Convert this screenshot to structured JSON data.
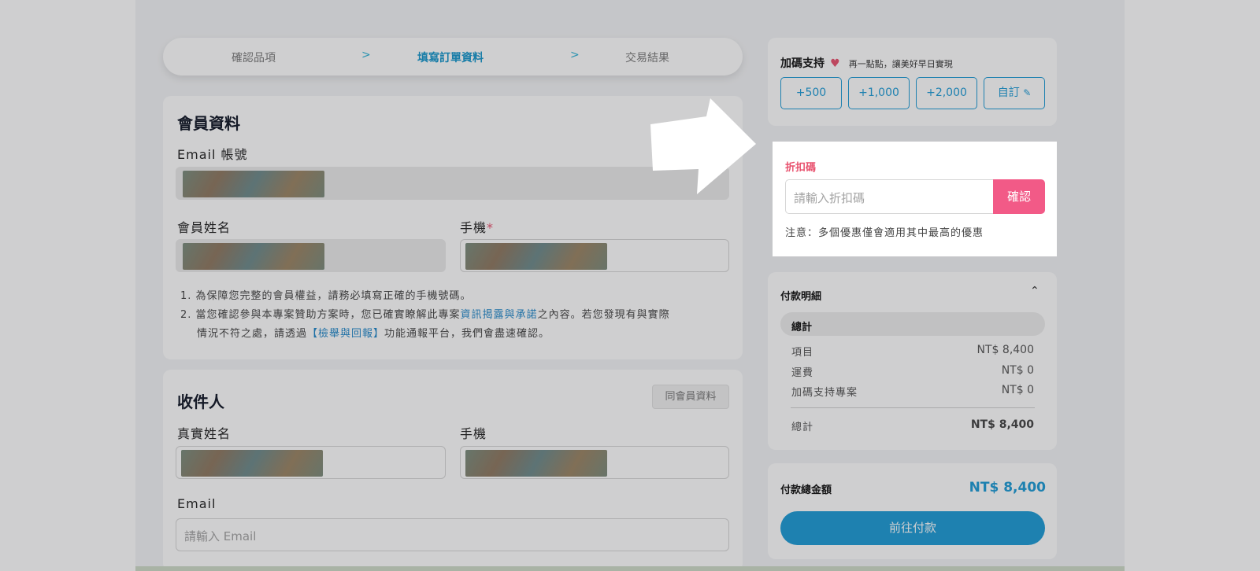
{
  "stepper": {
    "steps": [
      "確認品項",
      "填寫訂單資料",
      "交易結果"
    ],
    "separator": ">"
  },
  "member": {
    "title": "會員資料",
    "email_label": "Email 帳號",
    "name_label": "會員姓名",
    "phone_label": "手機",
    "required_mark": "*",
    "note1": "1. 為保障您完整的會員權益，請務必填寫正確的手機號碼。",
    "note2_pre": "2. 當您確認參與本專案贊助方案時，您已確實瞭解此專案",
    "note2_link": "資訊揭露與承諾",
    "note2_post": "之內容。若您發現有與實際",
    "note3_pre": "情況不符之處，請透過",
    "note3_link": "【檢舉與回報】",
    "note3_post": "功能通報平台，我們會盡速確認。"
  },
  "recipient": {
    "title": "收件人",
    "same_button": "同會員資料",
    "name_label": "真實姓名",
    "phone_label": "手機",
    "email_label": "Email",
    "email_placeholder": "請輸入 Email"
  },
  "support": {
    "title": "加碼支持",
    "subtitle": "再一點點，讓美好早日實現",
    "amounts": [
      "+500",
      "+1,000",
      "+2,000",
      "自訂"
    ]
  },
  "coupon": {
    "label": "折扣碼",
    "placeholder": "請輸入折扣碼",
    "confirm": "確認",
    "note": "注意：多個優惠僅會適用其中最高的優惠"
  },
  "payment": {
    "title": "付款明細",
    "total_header": "總計",
    "rows": [
      {
        "label": "項目",
        "value": "NT$ 8,400"
      },
      {
        "label": "運費",
        "value": "NT$ 0"
      },
      {
        "label": "加碼支持專案",
        "value": "NT$ 0"
      }
    ],
    "total_label": "總計",
    "total_value": "NT$ 8,400"
  },
  "grand": {
    "label": "付款總金額",
    "value": "NT$ 8,400",
    "button": "前往付款"
  },
  "colors": {
    "accent_blue": "#1d9bd7",
    "accent_pink": "#f25a87",
    "overlay": "rgba(35,35,40,0.22)"
  }
}
